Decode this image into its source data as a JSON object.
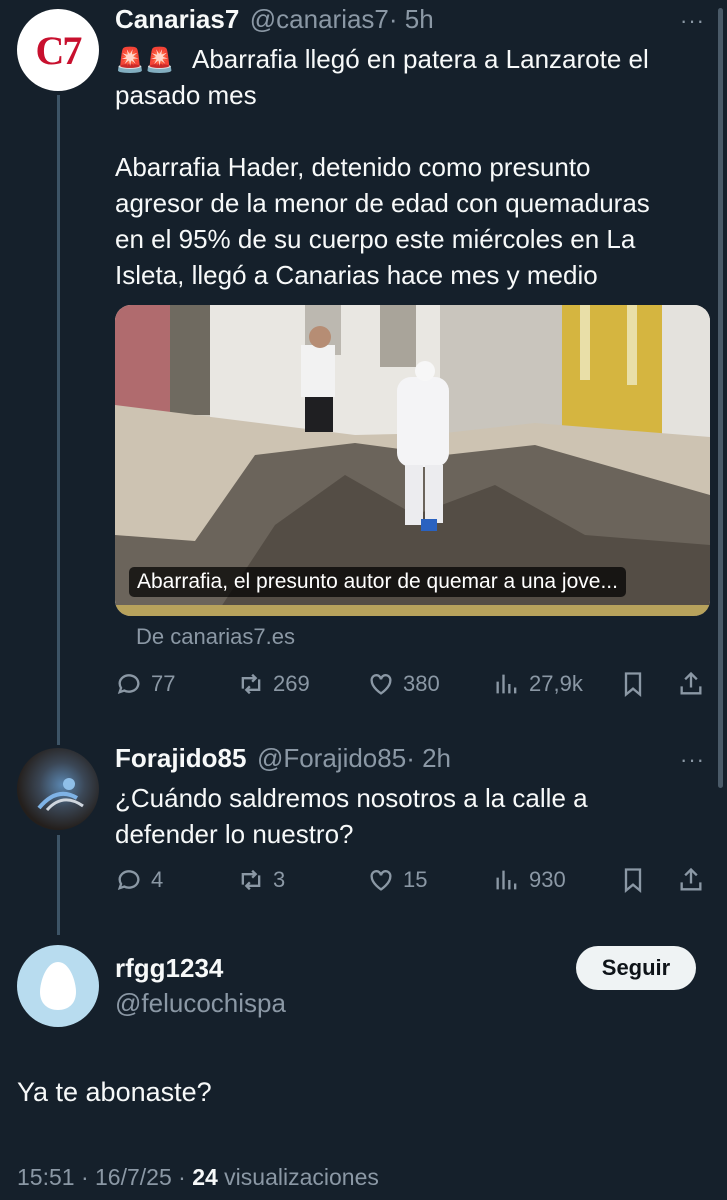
{
  "tweet1": {
    "name": "Canarias7",
    "handle": "@canarias7",
    "time": "· 5h",
    "more": "···",
    "avatar_text": "C7",
    "alarm_emoji": "🚨🚨",
    "headline": "Abarrafia llegó en patera a Lanzarote el",
    "headline2": "pasado mes",
    "para_lines": [
      "Abarrafia Hader, detenido como presunto",
      "agresor de la menor de edad con quemaduras",
      "en el 95% de su cuerpo este miércoles en La",
      "Isleta, llegó a Canarias hace mes y medio"
    ],
    "card_caption": "Abarrafia, el presunto autor de quemar a una jove...",
    "source": "De canarias7.es",
    "replies": "77",
    "retweets": "269",
    "likes": "380",
    "views": "27,9k"
  },
  "tweet2": {
    "name": "Forajido85",
    "handle": "@Forajido85",
    "time": "· 2h",
    "more": "···",
    "line1": "¿Cuándo saldremos nosotros a la calle a",
    "line2": "defender lo nuestro?",
    "replies": "4",
    "retweets": "3",
    "likes": "15",
    "views": "930"
  },
  "main": {
    "name": "rfgg1234",
    "handle": "@felucochispa",
    "follow_label": "Seguir",
    "text": "Ya te abonaste?",
    "meta_prefix": "15:51 · 16/7/25 · ",
    "views_count": "24",
    "views_label": " visualizaciones"
  },
  "icons": [
    "reply-icon",
    "retweet-icon",
    "like-icon",
    "views-icon",
    "bookmark-icon",
    "share-icon"
  ],
  "colors": {
    "background": "#15202b",
    "secondary_text": "#8b98a5",
    "logo_red": "#c8102e"
  }
}
